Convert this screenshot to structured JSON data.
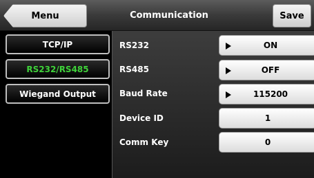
{
  "header": {
    "back_label": "Menu",
    "title": "Communication",
    "save_label": "Save"
  },
  "sidebar": {
    "items": [
      {
        "label": "TCP/IP",
        "active": false
      },
      {
        "label": "RS232/RS485",
        "active": true
      },
      {
        "label": "Wiegand Output",
        "active": false
      }
    ]
  },
  "settings": [
    {
      "label": "RS232",
      "value": "ON",
      "has_arrow": true
    },
    {
      "label": "RS485",
      "value": "OFF",
      "has_arrow": true
    },
    {
      "label": "Baud Rate",
      "value": "115200",
      "has_arrow": true
    },
    {
      "label": "Device ID",
      "value": "1",
      "has_arrow": false
    },
    {
      "label": "Comm Key",
      "value": "0",
      "has_arrow": false
    }
  ],
  "colors": {
    "active_text": "#3fd23a",
    "header_bg": "#3a3a3a"
  }
}
